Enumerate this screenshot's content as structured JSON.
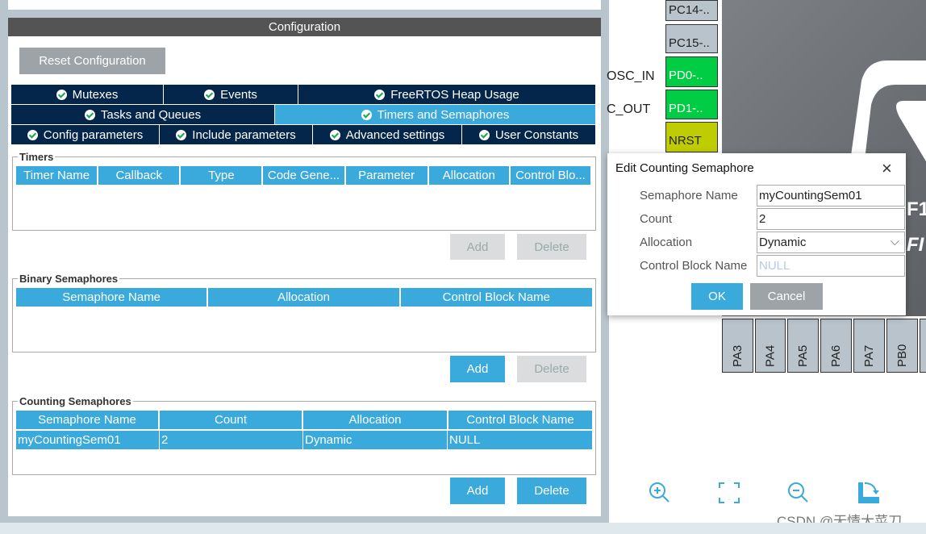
{
  "config": {
    "title": "Configuration",
    "reset_label": "Reset Configuration"
  },
  "tabs": {
    "row1": [
      "Mutexes",
      "Events",
      "FreeRTOS Heap Usage"
    ],
    "row2": [
      "Tasks and Queues",
      "Timers and Semaphores"
    ],
    "row3": [
      "Config parameters",
      "Include parameters",
      "Advanced settings",
      "User Constants"
    ],
    "active": "Timers and Semaphores"
  },
  "timers": {
    "title": "Timers",
    "columns": [
      "Timer Name",
      "Callback",
      "Type",
      "Code Gene...",
      "Parameter",
      "Allocation",
      "Control Blo..."
    ],
    "add": "Add",
    "delete": "Delete"
  },
  "binary": {
    "title": "Binary Semaphores",
    "columns": [
      "Semaphore Name",
      "Allocation",
      "Control Block Name"
    ],
    "add": "Add",
    "delete": "Delete"
  },
  "counting": {
    "title": "Counting Semaphores",
    "columns": [
      "Semaphore Name",
      "Count",
      "Allocation",
      "Control Block Name"
    ],
    "rows": [
      [
        "myCountingSem01",
        "2",
        "Dynamic",
        "NULL"
      ]
    ],
    "add": "Add",
    "delete": "Delete"
  },
  "pins": {
    "left": [
      "PC14-..",
      "PC15-..",
      "PD0-..",
      "PD1-..",
      "NRST"
    ],
    "left_labels": [
      "OSC_IN",
      "C_OUT"
    ],
    "bottom": [
      "PA3",
      "PA4",
      "PA5",
      "PA6",
      "PA7",
      "PB0"
    ],
    "chip_text": [
      "F1",
      "FI"
    ]
  },
  "dialog": {
    "title": "Edit Counting Semaphore",
    "name_label": "Semaphore Name",
    "name_value": "myCountingSem01",
    "count_label": "Count",
    "count_value": "2",
    "alloc_label": "Allocation",
    "alloc_value": "Dynamic",
    "cb_label": "Control Block Name",
    "cb_placeholder": "NULL",
    "ok": "OK",
    "cancel": "Cancel"
  },
  "watermark": "CSDN @无情大菜刀",
  "colors": {
    "accent": "#3aaadc",
    "tab_dark": "#04264a",
    "pin_green": "#00cc44",
    "pin_yellow": "#bfcc00"
  }
}
